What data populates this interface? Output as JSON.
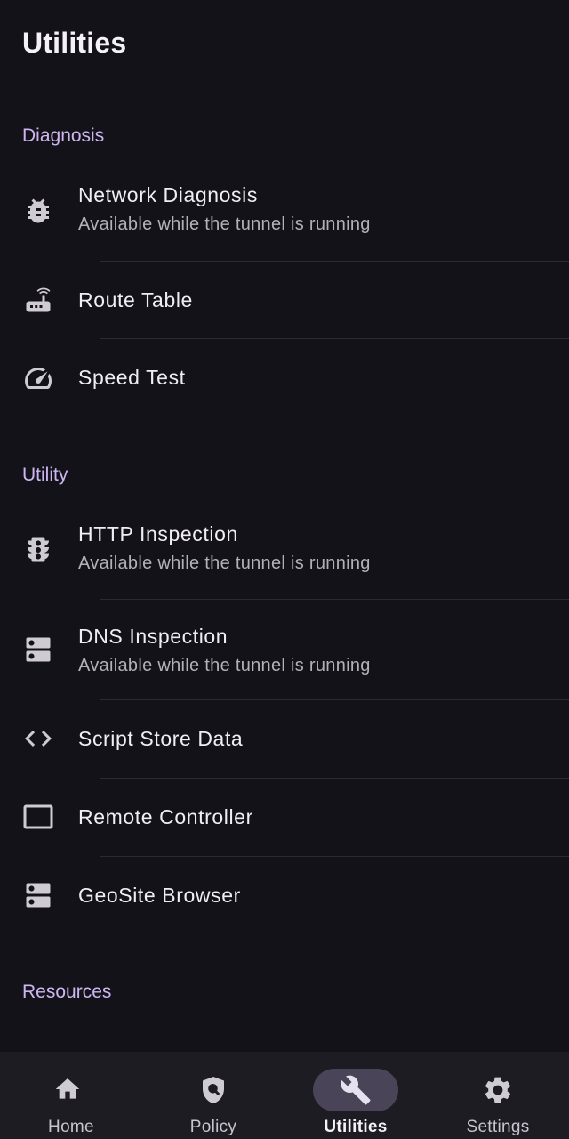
{
  "page": {
    "title": "Utilities"
  },
  "sections": {
    "diagnosis": "Diagnosis",
    "utility": "Utility",
    "resources": "Resources"
  },
  "items": {
    "network_diagnosis": {
      "title": "Network Diagnosis",
      "subtitle": "Available while the tunnel is running",
      "icon": "bug-icon"
    },
    "route_table": {
      "title": "Route Table",
      "icon": "router-icon"
    },
    "speed_test": {
      "title": "Speed Test",
      "icon": "speedometer-icon"
    },
    "http_inspection": {
      "title": "HTTP Inspection",
      "subtitle": "Available while the tunnel is running",
      "icon": "traffic-light-icon"
    },
    "dns_inspection": {
      "title": "DNS Inspection",
      "subtitle": "Available while the tunnel is running",
      "icon": "dns-icon"
    },
    "script_store": {
      "title": "Script Store Data",
      "icon": "code-icon"
    },
    "remote_controller": {
      "title": "Remote Controller",
      "icon": "screen-icon"
    },
    "geosite_browser": {
      "title": "GeoSite Browser",
      "icon": "dns-icon"
    }
  },
  "nav": {
    "home": "Home",
    "policy": "Policy",
    "utilities": "Utilities",
    "settings": "Settings",
    "active": "utilities"
  },
  "colors": {
    "background": "#131218",
    "section_header": "#cdb6f0",
    "nav_background": "#1e1c23",
    "active_pill": "#4a4458"
  }
}
